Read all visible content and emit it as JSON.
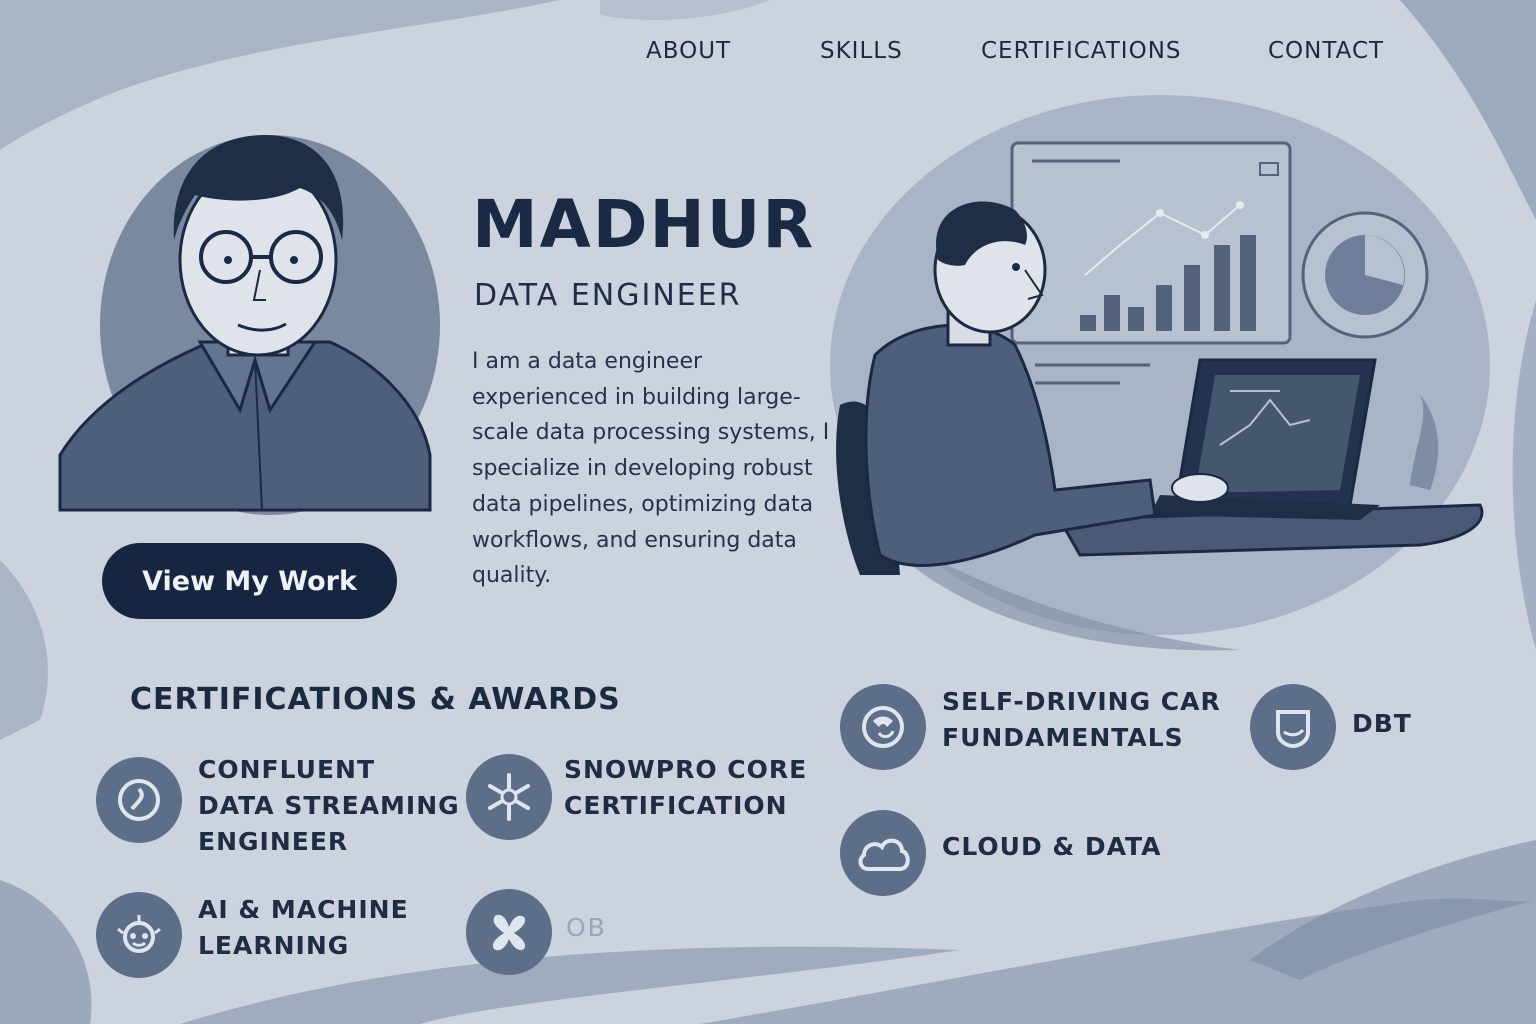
{
  "nav": {
    "about": "ABOUT",
    "skills": "SKILLS",
    "certifications": "CERTIFICATIONS",
    "contact": "CONTACT"
  },
  "hero": {
    "name": "MADHUR",
    "role": "DATA ENGINEER",
    "bio": "I am a data engineer experienced in building large-scale data processing systems, I specialize in developing robust data pipelines, optimizing data workflows, and ensuring data quality.",
    "cta_label": "View My Work"
  },
  "certifications": {
    "title": "CERTIFICATIONS & AWARDS",
    "items": [
      {
        "label": "CONFLUENT\nDATA STREAMING\nENGINEER",
        "icon": "confluent-icon"
      },
      {
        "label": "SNOWPRO CORE\nCERTIFICATION",
        "icon": "snowflake-icon"
      },
      {
        "label": "AI & MACHINE\nLEARNING",
        "icon": "robot-icon"
      },
      {
        "label": "OB",
        "icon": "x-logo-icon"
      },
      {
        "label": "SELF-DRIVING CAR\nFUNDAMENTALS",
        "icon": "car-icon"
      },
      {
        "label": "DBT",
        "icon": "dbt-icon"
      },
      {
        "label": "CLOUD & DATA",
        "icon": "cloud-icon"
      }
    ]
  },
  "colors": {
    "background": "#cdd3de",
    "navy": "#172640",
    "icon_bg": "#5d6e89",
    "brush": "#8f9db3"
  }
}
